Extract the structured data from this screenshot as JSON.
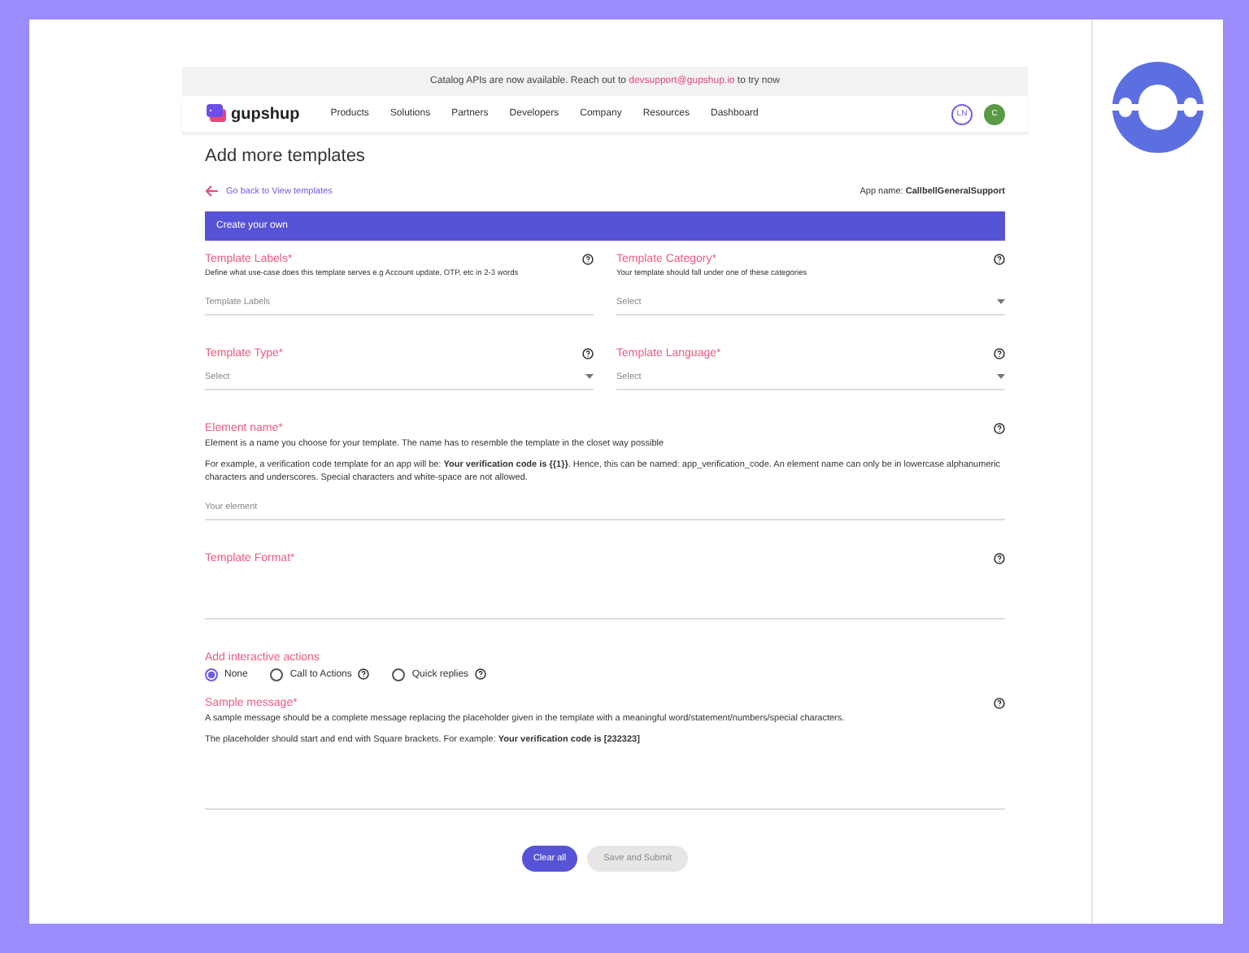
{
  "banner": {
    "text_before": "Catalog APIs are now available. Reach out to",
    "link": "devsupport@gupshup.io",
    "text_after": "to try now"
  },
  "nav": {
    "logo_text": "gupshup",
    "items": [
      "Products",
      "Solutions",
      "Partners",
      "Developers",
      "Company",
      "Resources",
      "Dashboard"
    ],
    "avatars": [
      {
        "initials": "LN",
        "kind": "outline"
      },
      {
        "initials": "C",
        "kind": "filled"
      }
    ]
  },
  "page": {
    "title": "Add more templates",
    "back_link": "Go back to View templates",
    "app_name_label": "App name:",
    "app_name_value": "CallbellGeneralSupport"
  },
  "section_header": "Create your own",
  "field_rows": [
    [
      {
        "kind": "text",
        "label": "Template Labels*",
        "hints": [
          "Define what use-case does this template serves e.g Account update, OTP, etc in 2-3 words"
        ],
        "placeholder": "Template Labels"
      },
      {
        "kind": "select",
        "label": "Template Category*",
        "hints": [
          "Your template should fall under one of these categories"
        ],
        "placeholder": "Select"
      }
    ],
    [
      {
        "kind": "select",
        "label": "Template Type*",
        "placeholder": "Select"
      },
      {
        "kind": "select",
        "label": "Template Language*",
        "placeholder": "Select"
      }
    ],
    [
      {
        "kind": "text",
        "label": "Element name*",
        "hints": [
          "Element is a name you choose for your template. The name has to resemble the template in the closet way possible",
          "For example, a verification code template for an app will be: **Your verification code is {{1}}**. Hence, this can be named: app_verification_code. An element name can only be in lowercase alphanumeric characters and underscores. Special characters and white-space are not allowed."
        ],
        "placeholder": "Your element"
      }
    ],
    [
      {
        "kind": "textarea",
        "label": "Template Format*"
      }
    ]
  ],
  "interactive_actions": {
    "label": "Add interactive actions",
    "options": [
      {
        "label": "None",
        "selected": true,
        "help": false
      },
      {
        "label": "Call to Actions",
        "selected": false,
        "help": true
      },
      {
        "label": "Quick replies",
        "selected": false,
        "help": true
      }
    ]
  },
  "sample_message": {
    "label": "Sample message*",
    "hints": [
      "A sample message should be a complete message replacing the placeholder given in the template with a meaningful word/statement/numbers/special characters.",
      "The placeholder should start and end with Square brackets. For example: **Your verification code is [232323]**"
    ]
  },
  "buttons": [
    {
      "label": "Clear all",
      "disabled": false
    },
    {
      "label": "Save and Submit",
      "disabled": true
    }
  ]
}
